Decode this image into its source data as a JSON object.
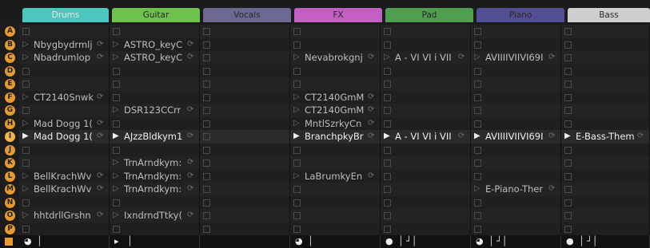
{
  "tracks": [
    {
      "name": "Drums",
      "color": "#4cc7bd"
    },
    {
      "name": "Guitar",
      "color": "#6cc24a"
    },
    {
      "name": "Vocals",
      "color": "#6b6891"
    },
    {
      "name": "FX",
      "color": "#c35ec2"
    },
    {
      "name": "Pad",
      "color": "#4f9e4f"
    },
    {
      "name": "Piano",
      "color": "#524e93"
    },
    {
      "name": "Bass",
      "color": "#cfcfcf"
    }
  ],
  "scenes": [
    "A",
    "B",
    "C",
    "D",
    "E",
    "F",
    "G",
    "H",
    "I",
    "J",
    "K",
    "L",
    "M",
    "N",
    "O",
    "P"
  ],
  "playing_scene": "I",
  "rows": [
    {
      "cells": [
        "",
        "",
        "",
        "",
        "",
        "",
        ""
      ]
    },
    {
      "cells": [
        "Nbygbydrmlj",
        "ASTRO_keyC",
        "",
        "",
        "",
        "",
        ""
      ]
    },
    {
      "cells": [
        "Nbadrumlop",
        "ASTRO_keyC",
        "",
        "Nevabrokgnj",
        "A - VI VI i VII",
        "AVIIIIVIIVI69I",
        ""
      ]
    },
    {
      "cells": [
        "",
        "",
        "",
        "",
        "",
        "",
        ""
      ]
    },
    {
      "cells": [
        "",
        "",
        "",
        "",
        "",
        "",
        ""
      ]
    },
    {
      "cells": [
        "CT2140Snwk",
        "",
        "",
        "CT2140GmM",
        "",
        "",
        ""
      ]
    },
    {
      "cells": [
        "",
        "DSR123CCrr",
        "",
        "CT2140GmM",
        "",
        "",
        ""
      ]
    },
    {
      "cells": [
        "Mad Dogg 1(",
        "",
        "",
        "MntlSzrkyCn",
        "",
        "",
        ""
      ]
    },
    {
      "cells": [
        "Mad Dogg 1(",
        "AJzzBldkym1",
        "",
        "BranchpkyBr",
        "A - VI VI i VII",
        "AVIIIIVIIVI69I",
        "E-Bass-Them"
      ]
    },
    {
      "cells": [
        "",
        "",
        "",
        "",
        "",
        "",
        ""
      ]
    },
    {
      "cells": [
        "",
        "TrnArndkym:",
        "",
        "",
        "",
        "",
        ""
      ]
    },
    {
      "cells": [
        "BellKrachWv",
        "TrnArndkym:",
        "",
        "LaBrumkyEn",
        "",
        "",
        ""
      ]
    },
    {
      "cells": [
        "BellKrachWv",
        "TrnArndkym:",
        "",
        "",
        "",
        "E-Piano-Ther",
        ""
      ]
    },
    {
      "cells": [
        "",
        "",
        "",
        "",
        "",
        "",
        ""
      ]
    },
    {
      "cells": [
        "hhtdrllGrshn",
        "IxndrndTtky(",
        "",
        "",
        "",
        "",
        ""
      ]
    },
    {
      "cells": [
        "",
        "",
        "",
        "",
        "",
        "",
        ""
      ]
    }
  ],
  "footer": [
    {
      "monitor": "mic-monitor-icon",
      "notes": "│"
    },
    {
      "monitor": "input-icon",
      "notes": "│"
    },
    {
      "monitor": "",
      "notes": ""
    },
    {
      "monitor": "mic-monitor-icon",
      "notes": "│"
    },
    {
      "monitor": "midi-icon",
      "notes": "│   ┘│"
    },
    {
      "monitor": "mic-monitor-icon",
      "notes": "│   ┘│"
    },
    {
      "monitor": "midi-icon",
      "notes": "│   ┘│"
    }
  ]
}
